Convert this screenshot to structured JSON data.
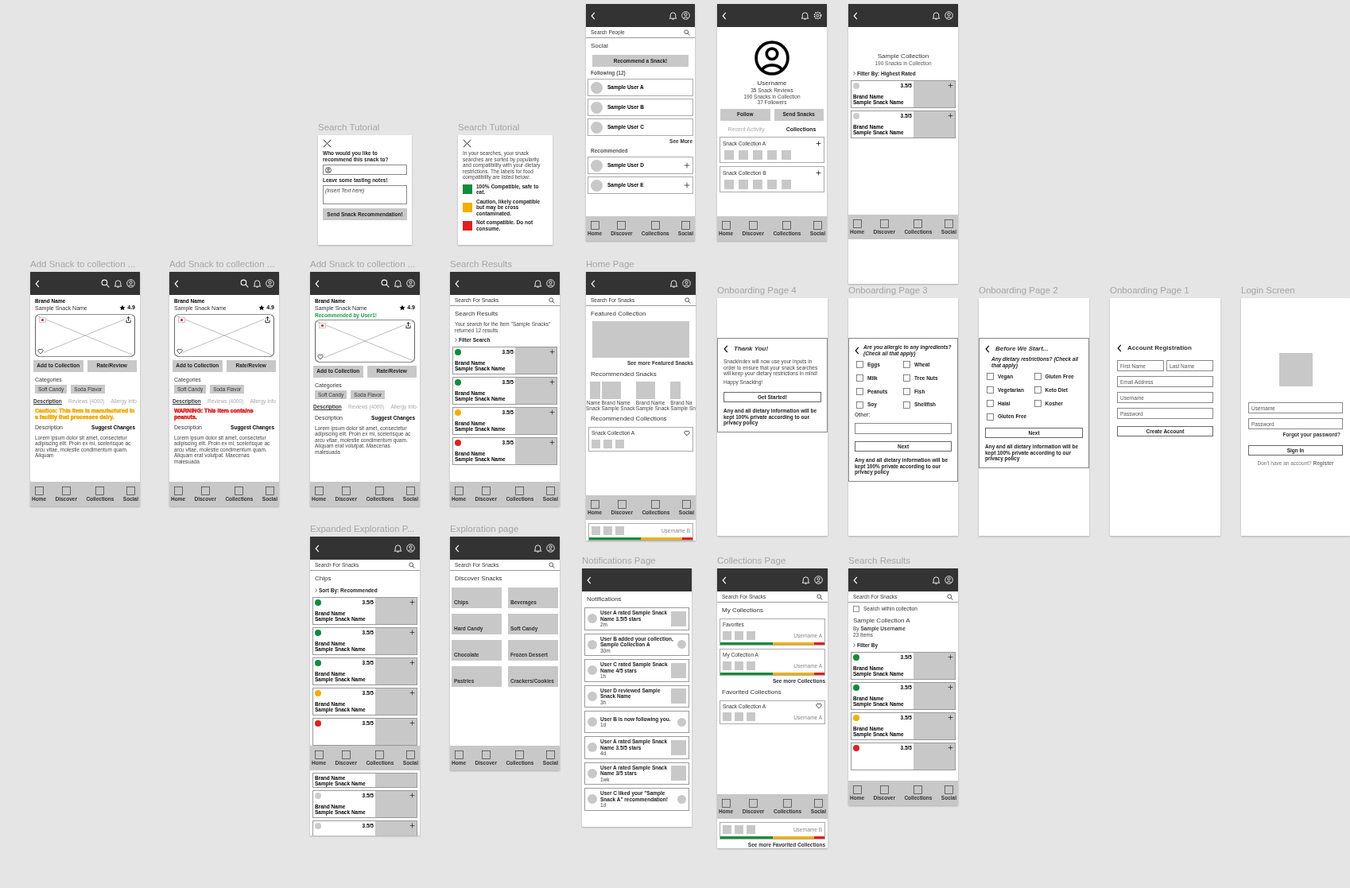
{
  "frames": [
    {
      "kind": "phone",
      "blocks": [
        {
          "kind": "header",
          "icons": [
            {
              "kind": "bell"
            },
            {
              "kind": "profile"
            }
          ]
        },
        {
          "kind": "search",
          "placeholder": "Search People"
        },
        {
          "kind": "heading",
          "text": "Social"
        },
        {
          "kind": "button",
          "label": "Recommend a Snack!"
        },
        {
          "kind": "small_label",
          "text": "Following (12)"
        },
        {
          "kind": "user",
          "name": "Sample User A",
          "add": false
        },
        {
          "kind": "user",
          "name": "Sample User B",
          "add": false
        },
        {
          "kind": "user",
          "name": "Sample User C",
          "add": false
        },
        {
          "kind": "right_link",
          "text": "See More"
        },
        {
          "kind": "small_label",
          "text": "Recommended"
        },
        {
          "kind": "user",
          "name": "Sample User D",
          "add": true
        },
        {
          "kind": "user",
          "name": "Sample User E",
          "add": true
        },
        {
          "kind": "nav",
          "items": [
            "Home",
            "Discover",
            "Collections",
            "Social"
          ]
        }
      ]
    },
    {
      "kind": "phone",
      "blocks": [
        {
          "kind": "header",
          "icons": [
            {
              "kind": "bell"
            },
            {
              "kind": "gear"
            }
          ]
        },
        {
          "kind": "avatar"
        },
        {
          "kind": "center_heading",
          "text": "Username"
        },
        {
          "kind": "stats",
          "lines": [
            "35 Snack Reviews",
            "190 Snacks in Collection",
            "37 Followers"
          ]
        },
        {
          "kind": "button_pair",
          "items": [
            "Follow",
            "Send Snacks"
          ]
        },
        {
          "kind": "section_tabs",
          "items": [
            {
              "label": "Recent Activity",
              "selected": false
            },
            {
              "label": "Collections",
              "selected": true
            }
          ]
        },
        {
          "kind": "coll_row",
          "title": "Snack Collection A"
        },
        {
          "kind": "coll_row",
          "title": "Snack Collection B"
        },
        {
          "kind": "nav",
          "items": [
            "Home",
            "Discover",
            "Collections",
            "Social"
          ]
        }
      ]
    },
    {
      "kind": "phone",
      "blocks": [
        {
          "kind": "header",
          "icons": [
            {
              "kind": "bell"
            },
            {
              "kind": "profile"
            }
          ]
        },
        {
          "kind": "blank"
        },
        {
          "kind": "center_heading",
          "text": "Sample Collection"
        },
        {
          "kind": "center_text",
          "text": "190 Snacks in Collection"
        },
        {
          "kind": "filter",
          "text": "Filter By: Highest Rated"
        },
        {
          "kind": "result",
          "color": "#cccccc",
          "rating": "3.5/5",
          "brand": "Brand Name",
          "name": "Sample Snack Name"
        },
        {
          "kind": "result",
          "color": "#cccccc",
          "rating": "3.5/5",
          "brand": "Brand Name",
          "name": "Sample Snack Name"
        },
        {
          "kind": "nav",
          "items": [
            "Home",
            "Discover",
            "Collections",
            "Social"
          ]
        },
        {
          "kind": "blank"
        },
        {
          "kind": "blank"
        }
      ]
    },
    {
      "kind": "modal",
      "title": "Search Tutorial",
      "blocks": [
        {
          "kind": "close"
        },
        {
          "kind": "bold_text",
          "text": "Who would you like to recommend this snack to?"
        },
        {
          "kind": "person_field"
        },
        {
          "kind": "bold_text",
          "text": "Leave some tasting notes!"
        },
        {
          "kind": "textarea",
          "placeholder": "(Insert Text here)"
        },
        {
          "kind": "button",
          "label": "Send Snack Recommendation!"
        }
      ]
    },
    {
      "kind": "modal",
      "title": "Search Tutorial",
      "blocks": [
        {
          "kind": "close"
        },
        {
          "kind": "text",
          "text": "In your searches, your snack searches are sorted by popularity and compatibility with your dietary restrictions. The labels for food compatibility are listed below:"
        },
        {
          "kind": "legend",
          "color": "#118c3c",
          "text": "100% Compatible, safe to eat."
        },
        {
          "kind": "legend",
          "color": "#f0b000",
          "text": "Caution, likely compatible but may be cross contaminated."
        },
        {
          "kind": "legend",
          "color": "#e02020",
          "text": "Not compatible. Do not consume."
        }
      ]
    },
    {
      "kind": "phone",
      "title": "Add Snack to collection ...",
      "blocks": [
        {
          "kind": "header",
          "icons": [
            {
              "kind": "search"
            },
            {
              "kind": "bell"
            },
            {
              "kind": "profile"
            }
          ]
        },
        {
          "kind": "product_head",
          "brand": "Brand Name",
          "name": "Sample Snack Name",
          "rating": "4.9"
        },
        {
          "kind": "photo"
        },
        {
          "kind": "button_pair",
          "items": [
            "Add to Collection",
            "Rate/Review"
          ]
        },
        {
          "kind": "label",
          "text": "Categories"
        },
        {
          "kind": "chips",
          "items": [
            "Soft Candy",
            "Soda Flavor"
          ]
        },
        {
          "kind": "tabs",
          "items": [
            {
              "label": "Description",
              "selected": true
            },
            {
              "label": "Reviews (4000)",
              "selected": false
            },
            {
              "label": "Allergy Info",
              "selected": false
            }
          ]
        },
        {
          "kind": "warning",
          "color": "#f0a800",
          "text": "Caution: This item is manufactured in a facility that processes dairy."
        },
        {
          "kind": "desc_head",
          "title": "Description",
          "action": "Suggest Changes"
        },
        {
          "kind": "text",
          "text": "Lorem ipsum dolor sit amet, consectetur adipiscing elit. Proin ex mi, scelerisque ac arcu vitae, molestie condimentum quam. Aliquam"
        },
        {
          "kind": "nav",
          "items": [
            "Home",
            "Discover",
            "Collections",
            "Social"
          ]
        }
      ]
    },
    {
      "kind": "phone",
      "title": "Add Snack to collection ...",
      "blocks": [
        {
          "kind": "header",
          "icons": [
            {
              "kind": "search"
            },
            {
              "kind": "bell"
            },
            {
              "kind": "profile"
            }
          ]
        },
        {
          "kind": "product_head",
          "brand": "Brand Name",
          "name": "Sample Snack Name",
          "rating": "4.9"
        },
        {
          "kind": "photo"
        },
        {
          "kind": "button_pair",
          "items": [
            "Add to Collection",
            "Rate/Review"
          ]
        },
        {
          "kind": "label",
          "text": "Categories"
        },
        {
          "kind": "chips",
          "items": [
            "Soft Candy",
            "Soda Flavor"
          ]
        },
        {
          "kind": "tabs",
          "items": [
            {
              "label": "Description",
              "selected": true
            },
            {
              "label": "Reviews (4000)",
              "selected": false
            },
            {
              "label": "Allergy Info",
              "selected": false
            }
          ]
        },
        {
          "kind": "warning",
          "color": "#e02020",
          "text": "WARNING: This item contains peanuts."
        },
        {
          "kind": "desc_head",
          "title": "Description",
          "action": "Suggest Changes"
        },
        {
          "kind": "text",
          "text": "Lorem ipsum dolor sit amet, consectetur adipiscing elit. Proin ex mi, scelerisque ac arcu vitae, molestie condimentum quam. Aliquam erat volutpat. Maecenas malesuada"
        },
        {
          "kind": "nav",
          "items": [
            "Home",
            "Discover",
            "Collections",
            "Social"
          ]
        }
      ]
    },
    {
      "kind": "phone",
      "title": "Add Snack to collection ...",
      "blocks": [
        {
          "kind": "header",
          "icons": [
            {
              "kind": "search"
            },
            {
              "kind": "bell"
            },
            {
              "kind": "profile"
            }
          ]
        },
        {
          "kind": "product_head",
          "brand": "Brand Name",
          "name": "Sample Snack Name",
          "rating": "4.9",
          "recommended": "Recommended by User1!"
        },
        {
          "kind": "photo"
        },
        {
          "kind": "button_pair",
          "items": [
            "Add to Collection",
            "Rate/Review"
          ]
        },
        {
          "kind": "label",
          "text": "Categories"
        },
        {
          "kind": "chips",
          "items": [
            "Soft Candy",
            "Soda Flavor"
          ]
        },
        {
          "kind": "tabs",
          "items": [
            {
              "label": "Description",
              "selected": true
            },
            {
              "label": "Reviews (4000)",
              "selected": false
            },
            {
              "label": "Allergy Info",
              "selected": false
            }
          ]
        },
        {
          "kind": "desc_head",
          "title": "Description",
          "action": "Suggest Changes"
        },
        {
          "kind": "text",
          "text": "Lorem ipsum dolor sit amet, consectetur adipiscing elit. Proin ex mi, scelerisque ac arcu vitae, molestie condimentum quam. Aliquam erat volutpat. Maecenas malesuada"
        },
        {
          "kind": "nav",
          "items": [
            "Home",
            "Discover",
            "Collections",
            "Social"
          ]
        }
      ]
    },
    {
      "kind": "phone",
      "title": "Search Results",
      "blocks": [
        {
          "kind": "header",
          "icons": [
            {
              "kind": "bell"
            },
            {
              "kind": "profile"
            }
          ]
        },
        {
          "kind": "search",
          "placeholder": "Search For Snacks"
        },
        {
          "kind": "heading",
          "text": "Search Results"
        },
        {
          "kind": "text",
          "text": "Your search for the item \"Sample Snacks\" returned 12 results"
        },
        {
          "kind": "filter",
          "text": "Filter Search"
        },
        {
          "kind": "result",
          "color": "#118c3c",
          "rating": "3.5/5",
          "brand": "Brand Name",
          "name": "Sample Snack Name"
        },
        {
          "kind": "result",
          "color": "#118c3c",
          "rating": "3.5/5",
          "brand": "Brand Name",
          "name": "Sample Snack Name"
        },
        {
          "kind": "result",
          "color": "#f0b000",
          "rating": "3.5/5",
          "brand": "Brand Name",
          "name": "Sample Snack Name"
        },
        {
          "kind": "result",
          "color": "#e02020",
          "rating": "3.5/5",
          "brand": "Brand Name",
          "name": "Sample Snack Name"
        },
        {
          "kind": "nav",
          "items": [
            "Home",
            "Discover",
            "Collections",
            "Social"
          ]
        }
      ]
    },
    {
      "kind": "phone",
      "title": "Home Page",
      "blocks": [
        {
          "kind": "header",
          "icons": [
            {
              "kind": "bell"
            },
            {
              "kind": "profile"
            }
          ]
        },
        {
          "kind": "search",
          "placeholder": "Search For Snacks"
        },
        {
          "kind": "heading",
          "text": "Featured Collection"
        },
        {
          "kind": "feature_block"
        },
        {
          "kind": "right_link",
          "text": "See more Featured Snacks"
        },
        {
          "kind": "heading",
          "text": "Recommended Snacks"
        },
        {
          "kind": "strip",
          "items": [
            {
              "brand": "Name",
              "name": "Snack"
            },
            {
              "brand": "Brand Name",
              "name": "Sample Snack"
            },
            {
              "brand": "Brand Name",
              "name": "Sample Snack"
            },
            {
              "brand": "Brand Na",
              "name": "Sample Sn"
            }
          ]
        },
        {
          "kind": "heading",
          "text": "Recommended Collections"
        },
        {
          "kind": "coll_card",
          "title": "Snack Collection A",
          "heart": true
        },
        {
          "kind": "nav",
          "items": [
            "Home",
            "Discover",
            "Collections",
            "Social"
          ]
        },
        {
          "kind": "coll_card",
          "heart": false,
          "owner": "Username B",
          "segments": [
            {
              "color": "#118c3c"
            },
            {
              "color": "#f0b000"
            },
            {
              "color": "#e02020"
            }
          ]
        }
      ]
    },
    {
      "kind": "onboarding",
      "title": "Onboarding Page 4",
      "blocks": [
        {
          "kind": "panel",
          "bordered": true,
          "blocks": [
            {
              "kind": "title_back",
              "text": "Thank You!",
              "italic": true
            },
            {
              "kind": "text",
              "text": "SnackIndex will now use your inputs in order to ensure that your snack searches will keep your dietary restrictions in mind!"
            },
            {
              "kind": "text",
              "text": "Happy Snacking!"
            },
            {
              "kind": "outline_button",
              "label": "Get Started!"
            },
            {
              "kind": "footnote",
              "text": "Any and all dietary information will be kept 100% private according to our privacy policy"
            }
          ]
        }
      ]
    },
    {
      "kind": "onboarding",
      "title": "Onboarding Page 3",
      "blocks": [
        {
          "kind": "panel",
          "bordered": true,
          "blocks": [
            {
              "kind": "question_back",
              "text": "Are you allergic to any ingredients? (Check all that apply)"
            },
            {
              "kind": "checks",
              "items": [
                {
                  "label": "Eggs",
                  "checked": false
                },
                {
                  "label": "Wheat",
                  "checked": false
                },
                {
                  "label": "Milk",
                  "checked": false
                },
                {
                  "label": "Tree Nuts",
                  "checked": false
                },
                {
                  "label": "Peanuts",
                  "checked": false
                },
                {
                  "label": "Fish",
                  "checked": false
                },
                {
                  "label": "Soy",
                  "checked": false
                },
                {
                  "label": "Shellfish",
                  "checked": false
                }
              ]
            },
            {
              "kind": "small_label",
              "text": "Other:"
            },
            {
              "kind": "input"
            },
            {
              "kind": "outline_button",
              "label": "Next"
            },
            {
              "kind": "footnote",
              "text": "Any and all dietary information will be kept 100% private according to our privacy policy"
            }
          ]
        }
      ]
    },
    {
      "kind": "onboarding",
      "title": "Onboarding Page 2",
      "blocks": [
        {
          "kind": "panel",
          "bordered": true,
          "blocks": [
            {
              "kind": "title_back",
              "text": "Before We Start...",
              "italic": true
            },
            {
              "kind": "question",
              "text": "Any dietary restrictions? (Check all that apply)"
            },
            {
              "kind": "checks",
              "items": [
                {
                  "label": "Vegan",
                  "checked": false
                },
                {
                  "label": "Gluten Free",
                  "checked": false
                },
                {
                  "label": "Vegetarian",
                  "checked": false
                },
                {
                  "label": "Keto Diet",
                  "checked": false
                },
                {
                  "label": "Halal",
                  "checked": false
                },
                {
                  "label": "Kosher",
                  "checked": false
                },
                {
                  "label": "Gluten Free",
                  "checked": false
                }
              ]
            },
            {
              "kind": "outline_button",
              "label": "Next"
            },
            {
              "kind": "footnote",
              "text": "Any and all dietary information will be kept 100% private according to our privacy policy"
            }
          ]
        }
      ]
    },
    {
      "kind": "onboarding",
      "title": "Onboarding Page 1",
      "blocks": [
        {
          "kind": "panel",
          "bordered": false,
          "blocks": [
            {
              "kind": "title_back",
              "text": "Account Registration",
              "italic": false
            },
            {
              "kind": "field_pair",
              "items": [
                {
                  "placeholder": "First Name"
                },
                {
                  "placeholder": "Last Name"
                }
              ]
            },
            {
              "kind": "input",
              "placeholder": "Email Address"
            },
            {
              "kind": "input",
              "placeholder": "Username"
            },
            {
              "kind": "input",
              "placeholder": "Password"
            },
            {
              "kind": "outline_button",
              "label": "Create Account"
            }
          ]
        }
      ]
    },
    {
      "kind": "onboarding",
      "title": "Login Screen",
      "blocks": [
        {
          "kind": "panel",
          "bordered": false,
          "blocks": [
            {
              "kind": "logo"
            },
            {
              "kind": "input",
              "placeholder": "Username"
            },
            {
              "kind": "input",
              "placeholder": "Password"
            },
            {
              "kind": "right_link",
              "text": "Forgot your password?"
            },
            {
              "kind": "outline_button",
              "label": "Sign In"
            },
            {
              "kind": "rich_center",
              "text": "Don't have an account? **Register**"
            }
          ]
        }
      ]
    },
    {
      "kind": "phone",
      "title": "Expanded Exploration P...",
      "blocks": [
        {
          "kind": "header",
          "icons": [
            {
              "kind": "bell"
            },
            {
              "kind": "profile"
            }
          ]
        },
        {
          "kind": "search",
          "placeholder": "Search For Snacks"
        },
        {
          "kind": "heading",
          "text": "Chips"
        },
        {
          "kind": "filter",
          "text": "Sort By: Recommended"
        },
        {
          "kind": "result",
          "color": "#118c3c",
          "rating": "3.5/5",
          "brand": "Brand Name",
          "name": "Sample Snack Name"
        },
        {
          "kind": "result",
          "color": "#118c3c",
          "rating": "3.5/5",
          "brand": "Brand Name",
          "name": "Sample Snack Name"
        },
        {
          "kind": "result",
          "color": "#118c3c",
          "rating": "3.5/5",
          "brand": "Brand Name",
          "name": "Sample Snack Name"
        },
        {
          "kind": "result",
          "color": "#f0b000",
          "rating": "3.5/5",
          "brand": "Brand Name",
          "name": "Sample Snack Name"
        },
        {
          "kind": "result",
          "color": "#e02020",
          "rating": "3.5/5"
        },
        {
          "kind": "nav",
          "items": [
            "Home",
            "Discover",
            "Collections",
            "Social"
          ]
        },
        {
          "kind": "result",
          "brand": "Brand Name",
          "name": "Sample Snack Name"
        },
        {
          "kind": "result",
          "color": "#cccccc",
          "rating": "3.5/5",
          "brand": "Brand Name",
          "name": "Sample Snack Name"
        },
        {
          "kind": "result",
          "color": "#cccccc",
          "rating": "3.5/5"
        }
      ]
    },
    {
      "kind": "phone",
      "title": "Exploration page",
      "blocks": [
        {
          "kind": "header",
          "icons": [
            {
              "kind": "bell"
            },
            {
              "kind": "profile"
            }
          ]
        },
        {
          "kind": "search",
          "placeholder": "Search For Snacks"
        },
        {
          "kind": "heading",
          "text": "Discover Snacks"
        },
        {
          "kind": "tiles",
          "items": [
            "Chips",
            "Beverages",
            "Hard Candy",
            "Soft Candy",
            "Chocolate",
            "Frozen Dessert",
            "Pastries",
            "Crackers/Cookies"
          ]
        },
        {
          "kind": "nav",
          "items": [
            "Home",
            "Discover",
            "Collections",
            "Social"
          ]
        }
      ]
    },
    {
      "kind": "phone",
      "title": "Notifications Page",
      "blocks": [
        {
          "kind": "header"
        },
        {
          "kind": "heading",
          "text": "Notifications"
        },
        {
          "kind": "notif",
          "text": "User A rated Sample Snack Name 3.5/5 stars",
          "time": "2m",
          "thumb": {
            "kind": "square"
          }
        },
        {
          "kind": "notif",
          "text": "User B added your collection, Sample Collection A",
          "time": "30m",
          "thumb": {
            "kind": "circle"
          }
        },
        {
          "kind": "notif",
          "text": "User C rated Sample Snack Name 4/5 stars",
          "time": "1h",
          "thumb": {
            "kind": "square"
          }
        },
        {
          "kind": "notif",
          "text": "User D reviewed Sample Snack Name",
          "time": "3h",
          "thumb": {
            "kind": "square"
          }
        },
        {
          "kind": "notif",
          "text": "User B is now following you.",
          "time": "1d",
          "thumb": {
            "kind": "circle"
          }
        },
        {
          "kind": "notif",
          "text": "User A rated Sample Snack Name 3.5/5 stars",
          "time": "4d",
          "thumb": {
            "kind": "square"
          }
        },
        {
          "kind": "notif",
          "text": "User A rated Sample Snack Name 3/5 stars",
          "time": "1wk",
          "thumb": {
            "kind": "square"
          }
        },
        {
          "kind": "notif",
          "text": "User C liked your \"Sample Snack A\" recommendation!",
          "time": "1d",
          "thumb": {
            "kind": "circle"
          }
        }
      ]
    },
    {
      "kind": "phone",
      "title": "Collections Page",
      "blocks": [
        {
          "kind": "header",
          "icons": [
            {
              "kind": "bell"
            },
            {
              "kind": "profile"
            }
          ]
        },
        {
          "kind": "search",
          "placeholder": "Search For Snacks"
        },
        {
          "kind": "heading",
          "text": "My Collections"
        },
        {
          "kind": "coll_card",
          "title": "Favorites",
          "heart": false,
          "owner": "Username A",
          "segments": [
            {
              "color": "#118c3c"
            },
            {
              "color": "#f0b000"
            },
            {
              "color": "#e02020"
            }
          ]
        },
        {
          "kind": "coll_card",
          "title": "My Collection A",
          "heart": false,
          "owner": "Username A",
          "segments": [
            {
              "color": "#118c3c"
            },
            {
              "color": "#f0b000"
            },
            {
              "color": "#e02020"
            }
          ]
        },
        {
          "kind": "right_link",
          "text": "See more Collections"
        },
        {
          "kind": "heading",
          "text": "Favorited Collections"
        },
        {
          "kind": "coll_card",
          "title": "Snack Collection A",
          "heart": true,
          "owner": "Username A"
        },
        {
          "kind": "nav",
          "items": [
            "Home",
            "Discover",
            "Collections",
            "Social"
          ]
        },
        {
          "kind": "coll_card",
          "heart": false,
          "owner": "Username B",
          "segments": [
            {
              "color": "#118c3c"
            },
            {
              "color": "#f0b000"
            },
            {
              "color": "#e02020"
            }
          ]
        },
        {
          "kind": "right_link",
          "text": "See more Favorited Collections"
        }
      ]
    },
    {
      "kind": "phone",
      "title": "Search Results",
      "blocks": [
        {
          "kind": "header",
          "icons": [
            {
              "kind": "bell"
            },
            {
              "kind": "profile"
            }
          ]
        },
        {
          "kind": "search",
          "placeholder": "Search For Snacks"
        },
        {
          "kind": "checkbox_row",
          "label": "Search within collection",
          "checked": false
        },
        {
          "kind": "heading",
          "text": "Sample Collection A"
        },
        {
          "kind": "rich_text",
          "text": "By **Sample Username**"
        },
        {
          "kind": "rich_text",
          "text": "23 Items"
        },
        {
          "kind": "filter",
          "text": "Filter By"
        },
        {
          "kind": "result",
          "color": "#118c3c",
          "rating": "3.5/5",
          "brand": "Brand Name",
          "name": "Sample Snack Name"
        },
        {
          "kind": "result",
          "color": "#118c3c",
          "rating": "3.5/5",
          "brand": "Brand Name",
          "name": "Sample Snack Name"
        },
        {
          "kind": "result",
          "color": "#f0b000",
          "rating": "3.5/5",
          "brand": "Brand Name",
          "name": "Sample Snack Name"
        },
        {
          "kind": "result",
          "color": "#e02020",
          "rating": "3.5/5"
        },
        {
          "kind": "nav",
          "items": [
            "Home",
            "Discover",
            "Collections",
            "Social"
          ]
        }
      ]
    }
  ]
}
